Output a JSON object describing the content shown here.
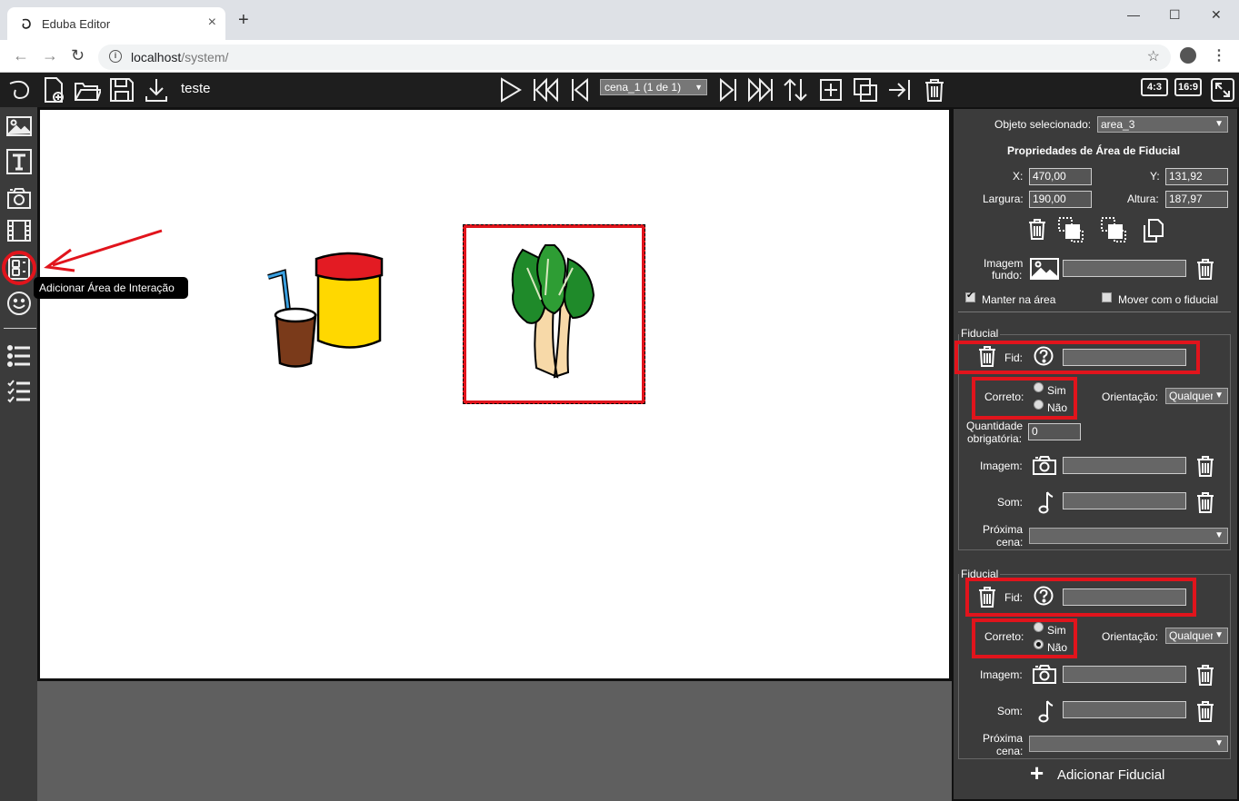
{
  "browser": {
    "tab_title": "Eduba Editor",
    "tab_close": "×",
    "new_tab": "+",
    "url_host": "localhost",
    "url_path": "/system/",
    "minimize": "—",
    "maximize": "☐",
    "close": "✕"
  },
  "toolbar": {
    "project_name": "teste",
    "scene_select": "cena_1 (1 de 1)",
    "ratio_43": "4:3",
    "ratio_169": "16:9"
  },
  "tooltip": "Adicionar Área de Interação",
  "panel": {
    "selected_label": "Objeto selecionado:",
    "selected_value": "area_3",
    "properties_title": "Propriedades de Área de Fiducial",
    "x_label": "X:",
    "x_value": "470,00",
    "y_label": "Y:",
    "y_value": "131,92",
    "width_label": "Largura:",
    "width_value": "190,00",
    "height_label": "Altura:",
    "height_value": "187,97",
    "bg_image_label_1": "Imagem",
    "bg_image_label_2": "fundo:",
    "keep_area_label": "Manter na área",
    "keep_area_checked": true,
    "move_fiducial_label": "Mover com o fiducial",
    "move_fiducial_checked": false,
    "add_fiducial": "Adicionar Fiducial"
  },
  "fiducials": [
    {
      "legend": "Fiducial",
      "fid_label": "Fid:",
      "fid_value": "",
      "correct_label": "Correto:",
      "yes_label": "Sim",
      "no_label": "Não",
      "correct_selected": "",
      "orientation_label": "Orientação:",
      "orientation_value": "Qualquer",
      "qty_label_1": "Quantidade",
      "qty_label_2": "obrigatória:",
      "qty_value": "0",
      "image_label": "Imagem:",
      "sound_label": "Som:",
      "next_label_1": "Próxima",
      "next_label_2": "cena:",
      "next_value": ""
    },
    {
      "legend": "Fiducial",
      "fid_label": "Fid:",
      "fid_value": "",
      "correct_label": "Correto:",
      "yes_label": "Sim",
      "no_label": "Não",
      "correct_selected": "Não",
      "orientation_label": "Orientação:",
      "orientation_value": "Qualquer",
      "image_label": "Imagem:",
      "sound_label": "Som:",
      "next_label_1": "Próxima",
      "next_label_2": "cena:",
      "next_value": ""
    }
  ],
  "colors": {
    "highlight": "#e1141c",
    "panel_bg": "#3b3b3b",
    "toolbar_bg": "#1e1e1e"
  }
}
